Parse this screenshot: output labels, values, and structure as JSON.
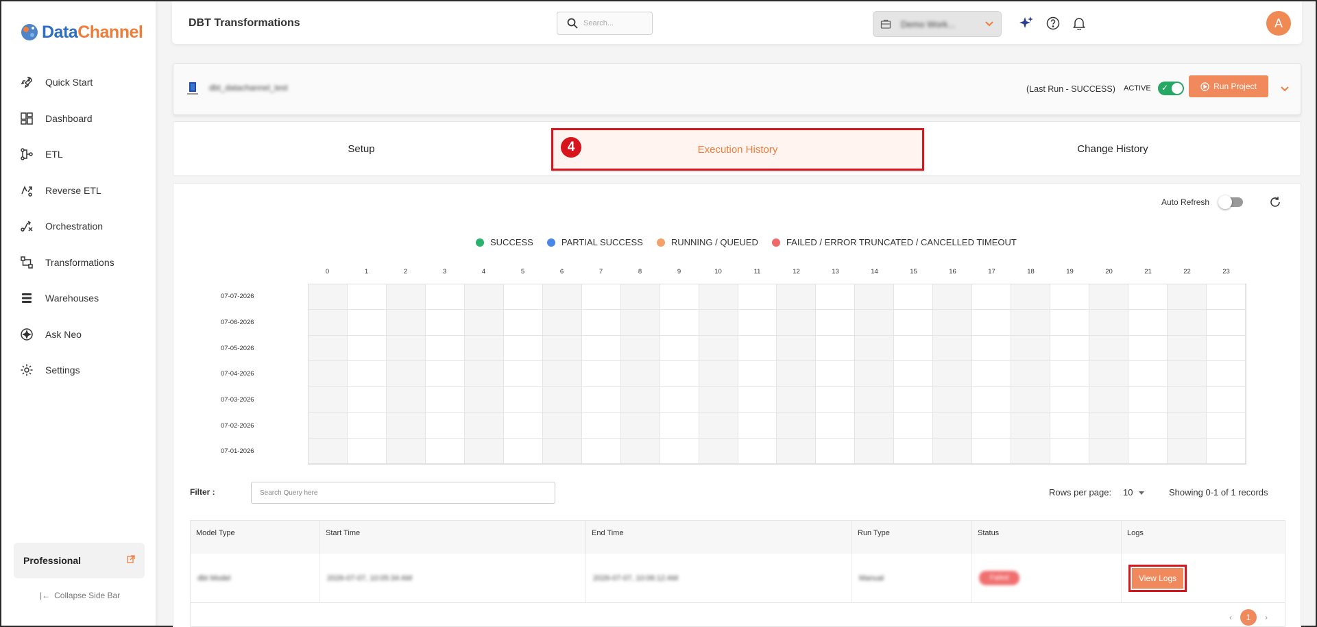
{
  "brand": {
    "part1": "Data",
    "part2": "Channel"
  },
  "sidebar": {
    "items": [
      {
        "label": "Quick Start",
        "icon": "rocket-icon"
      },
      {
        "label": "Dashboard",
        "icon": "dashboard-icon"
      },
      {
        "label": "ETL",
        "icon": "etl-icon"
      },
      {
        "label": "Reverse ETL",
        "icon": "reverse-etl-icon"
      },
      {
        "label": "Orchestration",
        "icon": "orchestration-icon"
      },
      {
        "label": "Transformations",
        "icon": "transformations-icon"
      },
      {
        "label": "Warehouses",
        "icon": "warehouses-icon"
      },
      {
        "label": "Ask Neo",
        "icon": "ask-neo-icon"
      },
      {
        "label": "Settings",
        "icon": "gear-icon"
      }
    ],
    "plan": "Professional",
    "collapse": "Collapse Side Bar"
  },
  "header": {
    "title": "DBT Transformations",
    "search_placeholder": "Search...",
    "workspace": "Demo Work...",
    "avatar": "A"
  },
  "project": {
    "name": "dbt_datachannel_test",
    "last_run": "(Last Run - SUCCESS)",
    "active_label": "ACTIVE",
    "active": true,
    "run_button": "Run Project"
  },
  "tabs": {
    "setup": "Setup",
    "execution": "Execution History",
    "change": "Change History",
    "step_number": "4"
  },
  "execution": {
    "auto_refresh": "Auto Refresh",
    "legend": [
      {
        "label": "SUCCESS",
        "color": "#27b36b"
      },
      {
        "label": "PARTIAL SUCCESS",
        "color": "#4a86e8"
      },
      {
        "label": "RUNNING / QUEUED",
        "color": "#f4a06b"
      },
      {
        "label": "FAILED / ERROR TRUNCATED / CANCELLED TIMEOUT",
        "color": "#ef6b6b"
      }
    ],
    "hours": [
      "0",
      "1",
      "2",
      "3",
      "4",
      "5",
      "6",
      "7",
      "8",
      "9",
      "10",
      "11",
      "12",
      "13",
      "14",
      "15",
      "16",
      "17",
      "18",
      "19",
      "20",
      "21",
      "22",
      "23"
    ],
    "dates": [
      "07-07-2026",
      "07-06-2026",
      "07-05-2026",
      "07-04-2026",
      "07-03-2026",
      "07-02-2026",
      "07-01-2026"
    ]
  },
  "filter": {
    "label": "Filter :",
    "placeholder": "Search Query here",
    "rows_per_page_label": "Rows per page:",
    "rows_per_page": "10",
    "showing": "Showing 0-1 of 1 records"
  },
  "table": {
    "headers": [
      "Model Type",
      "Start Time",
      "End Time",
      "Run Type",
      "Status",
      "Logs"
    ],
    "rows": [
      {
        "model_type": "dbt Model",
        "start": "2026-07-07, 10:05:34 AM",
        "end": "2026-07-07, 10:06:12 AM",
        "run_type": "Manual",
        "status": "Failed",
        "logs": "View Logs"
      }
    ]
  },
  "pager": {
    "page": "1"
  }
}
